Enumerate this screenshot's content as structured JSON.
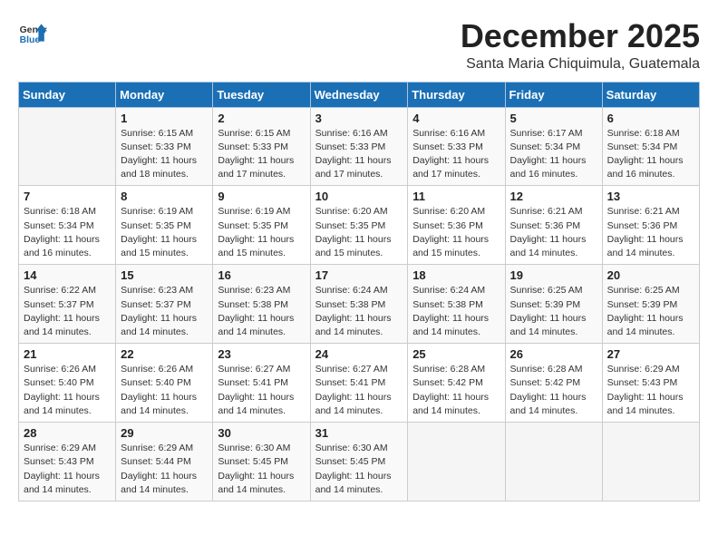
{
  "logo": {
    "general": "General",
    "blue": "Blue"
  },
  "header": {
    "month_year": "December 2025",
    "location": "Santa Maria Chiquimula, Guatemala"
  },
  "days_of_week": [
    "Sunday",
    "Monday",
    "Tuesday",
    "Wednesday",
    "Thursday",
    "Friday",
    "Saturday"
  ],
  "weeks": [
    [
      {
        "day": "",
        "sunrise": "",
        "sunset": "",
        "daylight": ""
      },
      {
        "day": "1",
        "sunrise": "Sunrise: 6:15 AM",
        "sunset": "Sunset: 5:33 PM",
        "daylight": "Daylight: 11 hours and 18 minutes."
      },
      {
        "day": "2",
        "sunrise": "Sunrise: 6:15 AM",
        "sunset": "Sunset: 5:33 PM",
        "daylight": "Daylight: 11 hours and 17 minutes."
      },
      {
        "day": "3",
        "sunrise": "Sunrise: 6:16 AM",
        "sunset": "Sunset: 5:33 PM",
        "daylight": "Daylight: 11 hours and 17 minutes."
      },
      {
        "day": "4",
        "sunrise": "Sunrise: 6:16 AM",
        "sunset": "Sunset: 5:33 PM",
        "daylight": "Daylight: 11 hours and 17 minutes."
      },
      {
        "day": "5",
        "sunrise": "Sunrise: 6:17 AM",
        "sunset": "Sunset: 5:34 PM",
        "daylight": "Daylight: 11 hours and 16 minutes."
      },
      {
        "day": "6",
        "sunrise": "Sunrise: 6:18 AM",
        "sunset": "Sunset: 5:34 PM",
        "daylight": "Daylight: 11 hours and 16 minutes."
      }
    ],
    [
      {
        "day": "7",
        "sunrise": "Sunrise: 6:18 AM",
        "sunset": "Sunset: 5:34 PM",
        "daylight": "Daylight: 11 hours and 16 minutes."
      },
      {
        "day": "8",
        "sunrise": "Sunrise: 6:19 AM",
        "sunset": "Sunset: 5:35 PM",
        "daylight": "Daylight: 11 hours and 15 minutes."
      },
      {
        "day": "9",
        "sunrise": "Sunrise: 6:19 AM",
        "sunset": "Sunset: 5:35 PM",
        "daylight": "Daylight: 11 hours and 15 minutes."
      },
      {
        "day": "10",
        "sunrise": "Sunrise: 6:20 AM",
        "sunset": "Sunset: 5:35 PM",
        "daylight": "Daylight: 11 hours and 15 minutes."
      },
      {
        "day": "11",
        "sunrise": "Sunrise: 6:20 AM",
        "sunset": "Sunset: 5:36 PM",
        "daylight": "Daylight: 11 hours and 15 minutes."
      },
      {
        "day": "12",
        "sunrise": "Sunrise: 6:21 AM",
        "sunset": "Sunset: 5:36 PM",
        "daylight": "Daylight: 11 hours and 14 minutes."
      },
      {
        "day": "13",
        "sunrise": "Sunrise: 6:21 AM",
        "sunset": "Sunset: 5:36 PM",
        "daylight": "Daylight: 11 hours and 14 minutes."
      }
    ],
    [
      {
        "day": "14",
        "sunrise": "Sunrise: 6:22 AM",
        "sunset": "Sunset: 5:37 PM",
        "daylight": "Daylight: 11 hours and 14 minutes."
      },
      {
        "day": "15",
        "sunrise": "Sunrise: 6:23 AM",
        "sunset": "Sunset: 5:37 PM",
        "daylight": "Daylight: 11 hours and 14 minutes."
      },
      {
        "day": "16",
        "sunrise": "Sunrise: 6:23 AM",
        "sunset": "Sunset: 5:38 PM",
        "daylight": "Daylight: 11 hours and 14 minutes."
      },
      {
        "day": "17",
        "sunrise": "Sunrise: 6:24 AM",
        "sunset": "Sunset: 5:38 PM",
        "daylight": "Daylight: 11 hours and 14 minutes."
      },
      {
        "day": "18",
        "sunrise": "Sunrise: 6:24 AM",
        "sunset": "Sunset: 5:38 PM",
        "daylight": "Daylight: 11 hours and 14 minutes."
      },
      {
        "day": "19",
        "sunrise": "Sunrise: 6:25 AM",
        "sunset": "Sunset: 5:39 PM",
        "daylight": "Daylight: 11 hours and 14 minutes."
      },
      {
        "day": "20",
        "sunrise": "Sunrise: 6:25 AM",
        "sunset": "Sunset: 5:39 PM",
        "daylight": "Daylight: 11 hours and 14 minutes."
      }
    ],
    [
      {
        "day": "21",
        "sunrise": "Sunrise: 6:26 AM",
        "sunset": "Sunset: 5:40 PM",
        "daylight": "Daylight: 11 hours and 14 minutes."
      },
      {
        "day": "22",
        "sunrise": "Sunrise: 6:26 AM",
        "sunset": "Sunset: 5:40 PM",
        "daylight": "Daylight: 11 hours and 14 minutes."
      },
      {
        "day": "23",
        "sunrise": "Sunrise: 6:27 AM",
        "sunset": "Sunset: 5:41 PM",
        "daylight": "Daylight: 11 hours and 14 minutes."
      },
      {
        "day": "24",
        "sunrise": "Sunrise: 6:27 AM",
        "sunset": "Sunset: 5:41 PM",
        "daylight": "Daylight: 11 hours and 14 minutes."
      },
      {
        "day": "25",
        "sunrise": "Sunrise: 6:28 AM",
        "sunset": "Sunset: 5:42 PM",
        "daylight": "Daylight: 11 hours and 14 minutes."
      },
      {
        "day": "26",
        "sunrise": "Sunrise: 6:28 AM",
        "sunset": "Sunset: 5:42 PM",
        "daylight": "Daylight: 11 hours and 14 minutes."
      },
      {
        "day": "27",
        "sunrise": "Sunrise: 6:29 AM",
        "sunset": "Sunset: 5:43 PM",
        "daylight": "Daylight: 11 hours and 14 minutes."
      }
    ],
    [
      {
        "day": "28",
        "sunrise": "Sunrise: 6:29 AM",
        "sunset": "Sunset: 5:43 PM",
        "daylight": "Daylight: 11 hours and 14 minutes."
      },
      {
        "day": "29",
        "sunrise": "Sunrise: 6:29 AM",
        "sunset": "Sunset: 5:44 PM",
        "daylight": "Daylight: 11 hours and 14 minutes."
      },
      {
        "day": "30",
        "sunrise": "Sunrise: 6:30 AM",
        "sunset": "Sunset: 5:45 PM",
        "daylight": "Daylight: 11 hours and 14 minutes."
      },
      {
        "day": "31",
        "sunrise": "Sunrise: 6:30 AM",
        "sunset": "Sunset: 5:45 PM",
        "daylight": "Daylight: 11 hours and 14 minutes."
      },
      {
        "day": "",
        "sunrise": "",
        "sunset": "",
        "daylight": ""
      },
      {
        "day": "",
        "sunrise": "",
        "sunset": "",
        "daylight": ""
      },
      {
        "day": "",
        "sunrise": "",
        "sunset": "",
        "daylight": ""
      }
    ]
  ]
}
